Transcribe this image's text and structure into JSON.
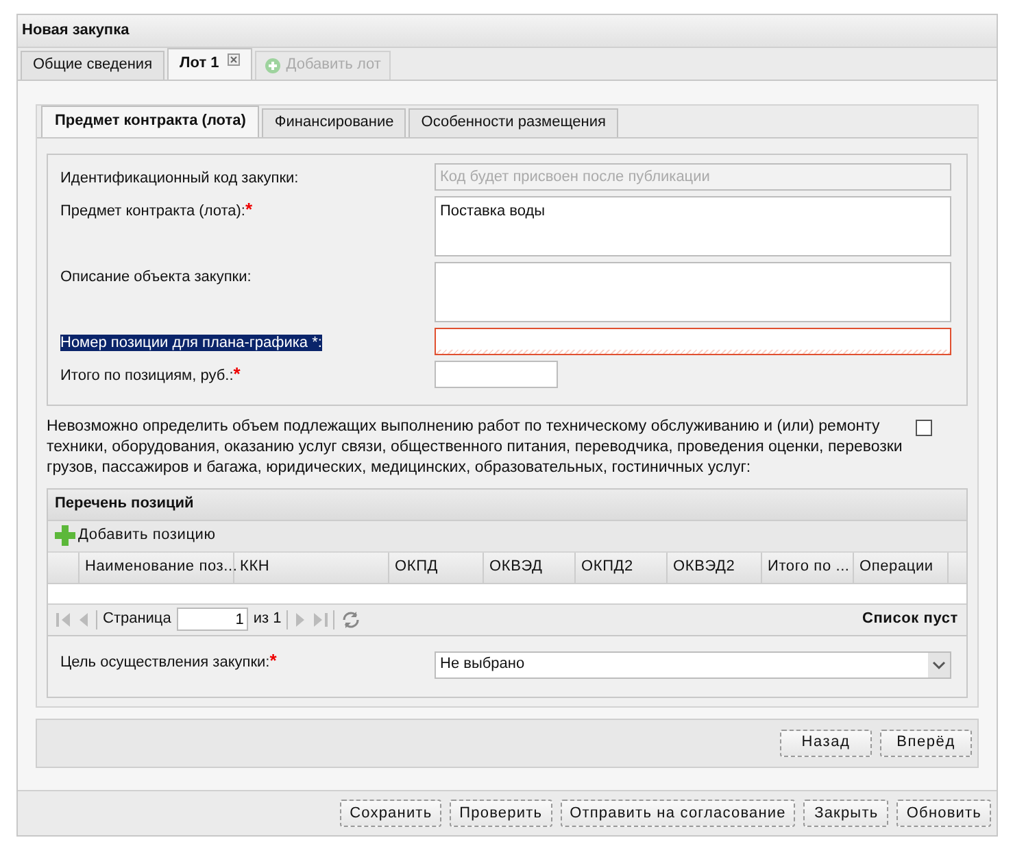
{
  "window": {
    "title": "Новая закупка"
  },
  "lot_tabs": [
    {
      "label": "Общие сведения",
      "selected": false,
      "closable": false
    },
    {
      "label": "Лот 1",
      "selected": true,
      "closable": true
    }
  ],
  "add_lot": {
    "label": "Добавить лот",
    "disabled": true
  },
  "section_tabs": [
    {
      "label": "Предмет контракта (лота)",
      "selected": true
    },
    {
      "label": "Финансирование",
      "selected": false
    },
    {
      "label": "Особенности размещения",
      "selected": false
    }
  ],
  "fields": [
    {
      "kind": "text",
      "label": "Идентификационный код закупки:",
      "placeholder": "Код будет присвоен после публикации",
      "disabled": true,
      "highlighted": false,
      "invalid": false
    },
    {
      "kind": "textarea",
      "label": "Предмет контракта (лота):",
      "required_mark": "*",
      "value": "Поставка воды",
      "disabled": false,
      "highlighted": false,
      "invalid": false
    },
    {
      "kind": "textarea",
      "label": "Описание объекта закупки:",
      "disabled": false,
      "highlighted": false,
      "invalid": false
    },
    {
      "kind": "text",
      "label": "Номер позиции для плана-графика *:",
      "disabled": false,
      "highlighted": true,
      "invalid": true
    },
    {
      "kind": "short",
      "label": "Итого по позициям, руб.:",
      "required_mark": "*",
      "disabled": false,
      "highlighted": false,
      "invalid": false
    }
  ],
  "notice": {
    "text": "Невозможно определить объем подлежащих выполнению работ по техническому обслуживанию и (или) ремонту техники, оборудования, оказанию услуг связи, общественного питания, переводчика, проведения оценки, перевозки грузов, пассажиров и багажа, юридических, медицинских, образовательных, гостиничных услуг:",
    "checked": false
  },
  "positions": {
    "title": "Перечень позиций",
    "add_label": "Добавить позицию",
    "columns": [
      "Наименование поз...",
      "ККН",
      "ОКПД",
      "ОКВЭД",
      "ОКПД2",
      "ОКВЭД2",
      "Итого по ...",
      "Операции"
    ],
    "pager": {
      "page_label": "Страница",
      "page": "1",
      "of": "из 1",
      "status": "Список пуст"
    }
  },
  "purpose": {
    "label": "Цель осуществления закупки:",
    "required_mark": "*",
    "value": "Не выбрано"
  },
  "nav_buttons": [
    "Назад",
    "Вперёд"
  ],
  "buttons": [
    "Сохранить",
    "Проверить",
    "Отправить на согласование",
    "Закрыть",
    "Обновить"
  ]
}
